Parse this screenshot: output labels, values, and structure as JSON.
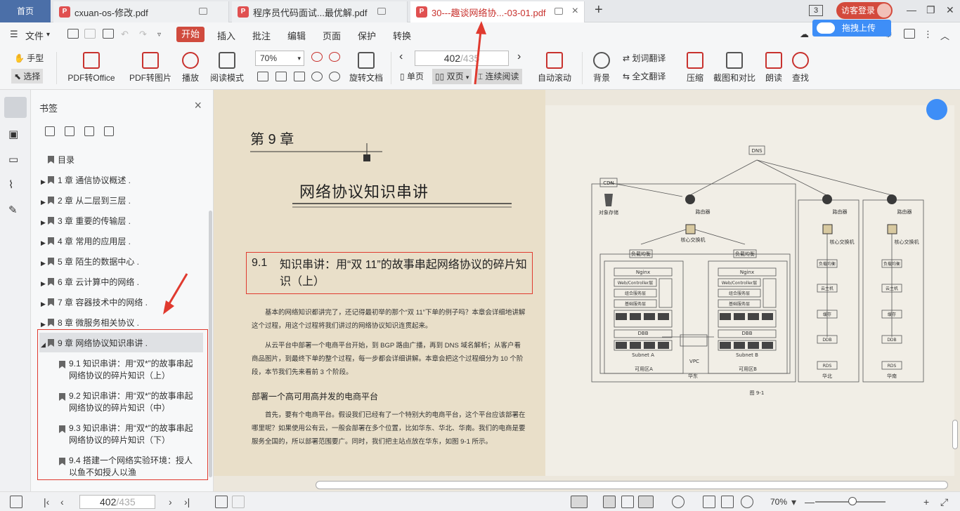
{
  "tabs": {
    "home": "首页",
    "items": [
      {
        "title": "cxuan-os-修改.pdf"
      },
      {
        "title": "程序员代码面试...最优解.pdf"
      },
      {
        "title": "30---趣谈网络协...-03-01.pdf"
      }
    ],
    "badge": "3",
    "visitor_login": "访客登录",
    "upload": "拖拽上传"
  },
  "menu": {
    "file": "文件",
    "items": [
      "开始",
      "插入",
      "批注",
      "编辑",
      "页面",
      "保护",
      "转换"
    ]
  },
  "ribbon": {
    "hand": "手型",
    "select": "选择",
    "pdf_to_office": "PDF转Office",
    "pdf_to_image": "PDF转图片",
    "play": "播放",
    "read_mode": "阅读模式",
    "zoom": "70%",
    "rotate": "旋转文档",
    "page_current": "402",
    "page_total": "/435",
    "single": "单页",
    "double": "双页",
    "continuous": "连续阅读",
    "auto_scroll": "自动滚动",
    "background": "背景",
    "word_translate": "划词翻译",
    "full_translate": "全文翻译",
    "compress": "压缩",
    "screenshot_compare": "截图和对比",
    "read_aloud": "朗读",
    "find": "查找"
  },
  "bookmarks": {
    "title": "书签",
    "root": "目录",
    "chapters": [
      "1 章 通信协议概述 .",
      "2 章 从二层到三层 .",
      "3 章 重要的传输层 .",
      "4 章 常用的应用层 .",
      "5 章 陌生的数据中心 .",
      "6 章 云计算中的网络 .",
      "7 章 容器技术中的网络 .",
      "8 章 微服务相关协议 .",
      "9 章 网络协议知识串讲 ."
    ],
    "sub": [
      "9.1 知识串讲：用“双*”的故事串起网络协议的碎片知识（上）",
      "9.2 知识串讲：用“双*”的故事串起网络协议的碎片知识（中）",
      "9.3 知识串讲：用“双*”的故事串起网络协议的碎片知识（下）",
      "9.4 搭建一个网络实验环境：授人以鱼不如授人以渔"
    ]
  },
  "page_left": {
    "chapter": "第 9 章",
    "chapter_title": "网络协议知识串讲",
    "section_num": "9.1",
    "section_title": "知识串讲：用“双 11”的故事串起网络协议的碎片知识（上）",
    "para1": "基本的网络知识都讲完了，还记得最初举的那个“双 11”下单的例子吗？本章会详细地讲解这个过程，用这个过程将我们讲过的网络协议知识连贯起来。",
    "para2": "从云平台中部署一个电商平台开始，到 BGP 路由广播，再到 DNS 域名解析；从客户看商品图片，到最终下单的整个过程，每一步都会详细讲解。本章会把这个过程细分为 10 个阶段，本节我们先来看前 3 个阶段。",
    "subheading": "部署一个高可用高并发的电商平台",
    "para3": "首先，要有个电商平台。假设我们已经有了一个特别大的电商平台，这个平台应该部署在哪里呢？如果使用公有云，一般会部署在多个位置，比如华东、华北、华南。我们的电商是要服务全国的，所以部署范围要广。同时，我们把主站点放在华东，如图 9-1 所示。"
  },
  "diagram": {
    "dns": "DNS",
    "cdn": "CDN",
    "obj_storage": "对象存储",
    "router": "路由器",
    "core_switch": "核心交换机",
    "lb": "负载均衡",
    "nginx": "Nginx",
    "web_layer": "Web/Controller层",
    "combo_service": "组合服务层",
    "base_service": "基础服务层",
    "cache_layer": "缓存层",
    "cache": "CACHE",
    "db": "DBB",
    "mysql": "MySQL",
    "gov_center": "治理中心",
    "sync_tool": "数据库同步工具",
    "subnet_a": "Subnet A",
    "subnet_b": "Subnet B",
    "vpc": "VPC",
    "az_a": "可用区A",
    "az_b": "可用区B",
    "east": "华东",
    "north": "华北",
    "south": "华南",
    "cloud_host": "云主机",
    "cache_cn": "缓存",
    "ddb": "DDB",
    "rds": "RDS",
    "fig": "图 9-1"
  },
  "statusbar": {
    "page_current": "402",
    "page_total": "/435",
    "zoom": "70%"
  }
}
